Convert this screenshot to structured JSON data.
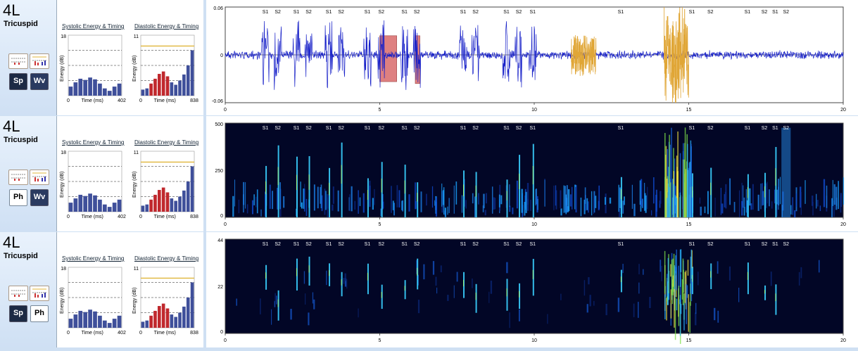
{
  "panels": [
    {
      "location": "4L",
      "valve": "Tricuspid",
      "view_buttons": [
        "Sp",
        "Wv"
      ],
      "plot_type": "waveform",
      "y_ticks": [
        "0.06",
        "0",
        "-0.06"
      ],
      "x_ticks": [
        "0",
        "5",
        "10",
        "15",
        "20"
      ]
    },
    {
      "location": "4L",
      "valve": "Tricuspid",
      "view_buttons": [
        "Ph",
        "Wv"
      ],
      "plot_type": "spectrogram",
      "y_ticks": [
        "500",
        "250",
        "0"
      ],
      "x_ticks": [
        "0",
        "5",
        "10",
        "15",
        "20"
      ]
    },
    {
      "location": "4L",
      "valve": "Tricuspid",
      "view_buttons": [
        "Sp",
        "Ph"
      ],
      "plot_type": "wavelet",
      "y_ticks": [
        "44",
        "22",
        "0"
      ],
      "x_ticks": [
        "0",
        "5",
        "10",
        "15",
        "20"
      ]
    }
  ],
  "energy": {
    "systolic_title": "Systolic Energy & Timing",
    "diastolic_title": "Diastolic Energy & Timing",
    "ylabel": "Energy (dB)",
    "xlabel": "Time (ms)",
    "systolic_ymax": "18",
    "systolic_xmax": "402",
    "diastolic_ymax": "11",
    "diastolic_xmax": "838",
    "origin": "0",
    "systolic_bars": [
      0.15,
      0.22,
      0.28,
      0.26,
      0.3,
      0.27,
      0.2,
      0.12,
      0.08,
      0.15,
      0.2
    ],
    "diastolic_bars": [
      0.1,
      0.12,
      0.2,
      0.28,
      0.36,
      0.4,
      0.32,
      0.22,
      0.18,
      0.25,
      0.35,
      0.5,
      0.75
    ],
    "diastolic_highlight_range": [
      2,
      6
    ],
    "bar_color": "#3f4f9a",
    "highlight_color": "#c0282d",
    "threshold_color": "#e0b63a"
  },
  "annotations": [
    {
      "label": "S1",
      "t": 2.6
    },
    {
      "label": "S2",
      "t": 3.4
    },
    {
      "label": "S1",
      "t": 4.6
    },
    {
      "label": "S2",
      "t": 5.4
    },
    {
      "label": "S1",
      "t": 6.7
    },
    {
      "label": "S2",
      "t": 7.5
    },
    {
      "label": "S1",
      "t": 9.2
    },
    {
      "label": "S2",
      "t": 10.1
    },
    {
      "label": "S1",
      "t": 11.6
    },
    {
      "label": "S2",
      "t": 12.4
    },
    {
      "label": "S1",
      "t": 15.4
    },
    {
      "label": "S2",
      "t": 16.2
    },
    {
      "label": "S1",
      "t": 18.2
    },
    {
      "label": "S2",
      "t": 19.0
    },
    {
      "label": "S1",
      "t": 19.9
    },
    {
      "label": "S1",
      "t": 25.6
    },
    {
      "label": "S1",
      "t": 30.2
    },
    {
      "label": "S2",
      "t": 31.4
    },
    {
      "label": "S1",
      "t": 33.8
    },
    {
      "label": "S2",
      "t": 34.9
    },
    {
      "label": "S1",
      "t": 35.6
    },
    {
      "label": "S2",
      "t": 36.3
    }
  ],
  "x_max": 20,
  "colors": {
    "waveform": "#1720c8",
    "murmur": "#e0a636",
    "segment": "#d96a6a",
    "spec_bg": "#020626"
  }
}
